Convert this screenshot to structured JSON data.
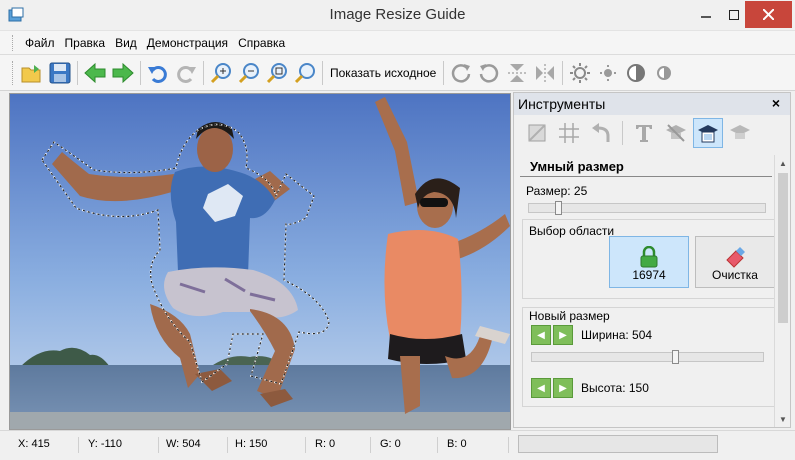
{
  "window": {
    "title": "Image Resize Guide"
  },
  "menu": [
    "Файл",
    "Правка",
    "Вид",
    "Демонстрация",
    "Справка"
  ],
  "toolbar": {
    "icons": [
      "open-folder-icon",
      "save-icon",
      "back-arrow-icon",
      "forward-arrow-icon",
      "undo-icon",
      "redo-icon",
      "zoom-in-icon",
      "zoom-out-icon",
      "zoom-fit-icon",
      "zoom-actual-icon",
      "rotate-right-icon",
      "rotate-left-icon",
      "flip-vertical-icon",
      "flip-horizontal-icon",
      "brightness-up-icon",
      "brightness-down-icon",
      "contrast-up-icon",
      "contrast-down-icon"
    ],
    "show_original_label": "Показать исходное"
  },
  "panel": {
    "title": "Инструменты",
    "close_glyph": "×",
    "section_title": "Умный размер",
    "size_label": "Размер: 25",
    "size_value": 25,
    "area_group_title": "Выбор области",
    "lock_count": "16974",
    "clear_label": "Очистка",
    "new_size_title": "Новый размер",
    "width_label": "Ширина: 504",
    "height_label": "Высота: 150"
  },
  "status": {
    "x": "X: 415",
    "y": "Y: -110",
    "w": "W: 504",
    "h": "H: 150",
    "r": "R: 0",
    "g": "G: 0",
    "b": "B: 0"
  },
  "colors": {
    "accent_blue": "#cde6fb",
    "close_red": "#c8463b",
    "green_arrow": "#7fbe5a"
  }
}
